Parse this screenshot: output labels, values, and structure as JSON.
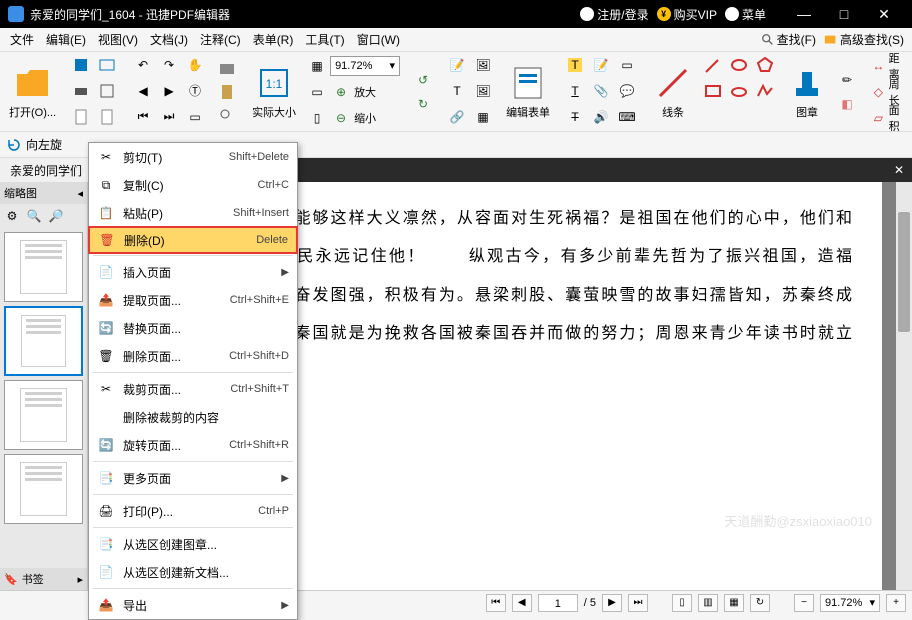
{
  "titlebar": {
    "title": "亲爱的同学们_1604 - 迅捷PDF编辑器",
    "register": "注册/登录",
    "buy_vip": "购买VIP",
    "menu": "菜单"
  },
  "menubar": {
    "file": "文件",
    "edit": "编辑(E)",
    "view": "视图(V)",
    "document": "文档(J)",
    "comment": "注释(C)",
    "form": "表单(R)",
    "tool": "工具(T)",
    "window": "窗口(W)",
    "search": "查找(F)",
    "adv_search": "高级查找(S)"
  },
  "ribbon": {
    "open": "打开(O)...",
    "zoom_value": "91.72%",
    "actual_size": "实际大小",
    "zoom_in": "放大",
    "zoom_out": "缩小",
    "edit_form": "编辑表单",
    "line": "线条",
    "image": "图章",
    "distance": "距离",
    "perimeter": "周长",
    "area": "面积"
  },
  "rotatebar": {
    "rotate_left": "向左旋"
  },
  "tab": {
    "label": "亲爱的同学们"
  },
  "sidebar": {
    "thumbs_title": "缩略图",
    "bookmarks": "书签"
  },
  "document_text": "壮抉择。他们为什么能够这样大义凛然，从容面对生死祸福？是祖国在他们的心中，他们和祖国在一起，祖国人民永远记住他！\n　　纵观古今，有多少前辈先哲为了振兴祖国，造福人民，而放弃一切，奋发图强，积极有为。悬梁刺股、囊萤映雪的故事妇孺皆知，苏秦终成大儒，他说六国抗击秦国就是为挽救各国被秦国吞并而做的努力；周恩来青少年读书时就立下了\"为中",
  "context_menu": {
    "cut": "剪切(T)",
    "cut_sc": "Shift+Delete",
    "copy": "复制(C)",
    "copy_sc": "Ctrl+C",
    "paste": "粘贴(P)",
    "paste_sc": "Shift+Insert",
    "delete": "删除(D)",
    "delete_sc": "Delete",
    "insert_page": "插入页面",
    "extract_page": "提取页面...",
    "extract_sc": "Ctrl+Shift+E",
    "replace_page": "替换页面...",
    "delete_page": "删除页面...",
    "delete_page_sc": "Ctrl+Shift+D",
    "crop_page": "裁剪页面...",
    "crop_sc": "Ctrl+Shift+T",
    "delete_crop": "删除被裁剪的内容",
    "rotate_page": "旋转页面...",
    "rotate_sc": "Ctrl+Shift+R",
    "more_pages": "更多页面",
    "print": "打印(P)...",
    "print_sc": "Ctrl+P",
    "create_chapter": "从选区创建图章...",
    "create_doc": "从选区创建新文档...",
    "export": "导出"
  },
  "statusbar": {
    "page_current": "1",
    "page_total": "/ 5",
    "zoom": "91.72%"
  },
  "watermark": "天道酬勤@zsxiaoxiao010"
}
